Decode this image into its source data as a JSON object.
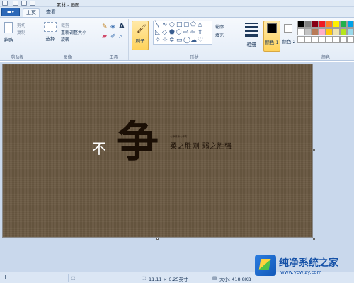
{
  "window": {
    "title": "素材 - 画图"
  },
  "tabs": {
    "file": "▬▾",
    "home": "主页",
    "view": "查看"
  },
  "ribbon": {
    "clipboard": {
      "paste": "粘贴",
      "cut": "剪切",
      "copy": "复制",
      "group": "剪贴板"
    },
    "image": {
      "select": "选择",
      "crop": "裁剪",
      "resize": "重新调整大小",
      "rotate": "旋转",
      "group": "图像"
    },
    "tools": {
      "group": "工具",
      "text_tool": "A"
    },
    "brushes": {
      "label": "刷子"
    },
    "shapes": {
      "outline": "轮廓",
      "fill": "填充",
      "group": "形状"
    },
    "size": {
      "label": "粗细"
    },
    "colors": {
      "color1": "颜色 1",
      "color2": "颜色 2",
      "group": "颜色",
      "color1_value": "#000000",
      "color2_value": "#ffffff"
    }
  },
  "palette": [
    "#000000",
    "#7f7f7f",
    "#880015",
    "#ed1c24",
    "#ff7f27",
    "#fff200",
    "#22b14c",
    "#00a2e8",
    "#ffffff",
    "#c3c3c3",
    "#b97a57",
    "#ffaec9",
    "#ffc90e",
    "#efe4b0",
    "#b5e61d",
    "#99d9ea",
    "#ffffff",
    "#ffffff",
    "#ffffff",
    "#ffffff",
    "#ffffff",
    "#ffffff",
    "#ffffff",
    "#ffffff"
  ],
  "canvas_art": {
    "bu": "不",
    "zheng": "争",
    "small_print": "心静修身心怀方",
    "motto": "柔之胜刚 弱之胜强",
    "background": "#6b5a43"
  },
  "status": {
    "dimensions": "11.11 × 6.25英寸",
    "size": "大小: 418.8KB"
  },
  "watermark": {
    "name": "纯净系统之家",
    "url": "www.ycwjzy.com"
  }
}
